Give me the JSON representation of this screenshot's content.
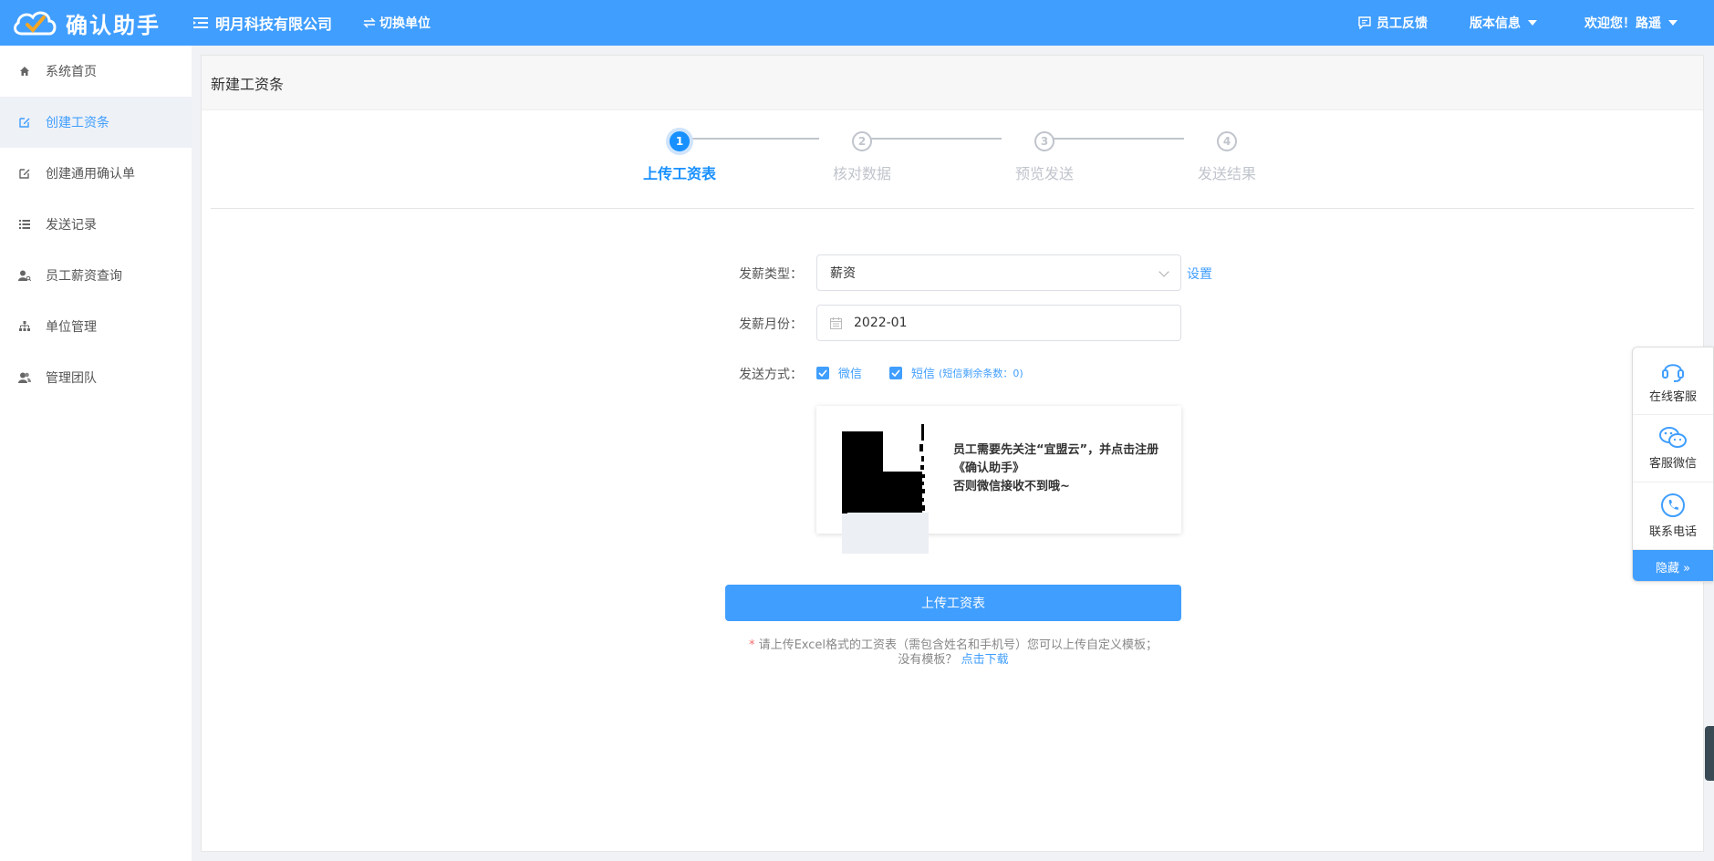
{
  "header": {
    "app_name": "确认助手",
    "company": "明月科技有限公司",
    "switch_label": "切换单位",
    "feedback_label": "员工反馈",
    "version_label": "版本信息",
    "welcome_label": "欢迎您！路遥"
  },
  "sidebar": {
    "items": [
      {
        "label": "系统首页",
        "icon": "home-icon"
      },
      {
        "label": "创建工资条",
        "icon": "edit-icon",
        "active": true
      },
      {
        "label": "创建通用确认单",
        "icon": "edit-icon"
      },
      {
        "label": "发送记录",
        "icon": "list-icon"
      },
      {
        "label": "员工薪资查询",
        "icon": "user-search-icon"
      },
      {
        "label": "单位管理",
        "icon": "org-tree-icon"
      },
      {
        "label": "管理团队",
        "icon": "team-icon"
      }
    ]
  },
  "panel": {
    "title": "新建工资条"
  },
  "steps": [
    {
      "num": "1",
      "label": "上传工资表",
      "active": true
    },
    {
      "num": "2",
      "label": "核对数据"
    },
    {
      "num": "3",
      "label": "预览发送"
    },
    {
      "num": "4",
      "label": "发送结果"
    }
  ],
  "form": {
    "pay_type_label": "发薪类型：",
    "pay_type_value": "薪资",
    "settings_link": "设置",
    "pay_month_label": "发薪月份：",
    "pay_month_value": "2022-01",
    "send_method_label": "发送方式：",
    "wechat_label": "微信",
    "sms_label": "短信",
    "sms_remaining": "(短信剩余条数：0)"
  },
  "qr_card": {
    "line1": "员工需要先关注“宜盟云”，并点击注册《确认助手》",
    "line2": "否则微信接收不到哦~"
  },
  "upload": {
    "button_label": "上传工资表",
    "hint_star": "*",
    "hint_text": " 请上传Excel格式的工资表（需包含姓名和手机号）您可以上传自定义模板；",
    "hint_line2": "没有模板？",
    "download_link": "点击下载"
  },
  "float_panel": {
    "online_service": "在线客服",
    "wechat_service": "客服微信",
    "contact_phone": "联系电话",
    "hide_label": "隐藏 »"
  },
  "colors": {
    "primary": "#409eff",
    "step_active": "#1890ff",
    "step_inactive": "#c0c4cc"
  }
}
